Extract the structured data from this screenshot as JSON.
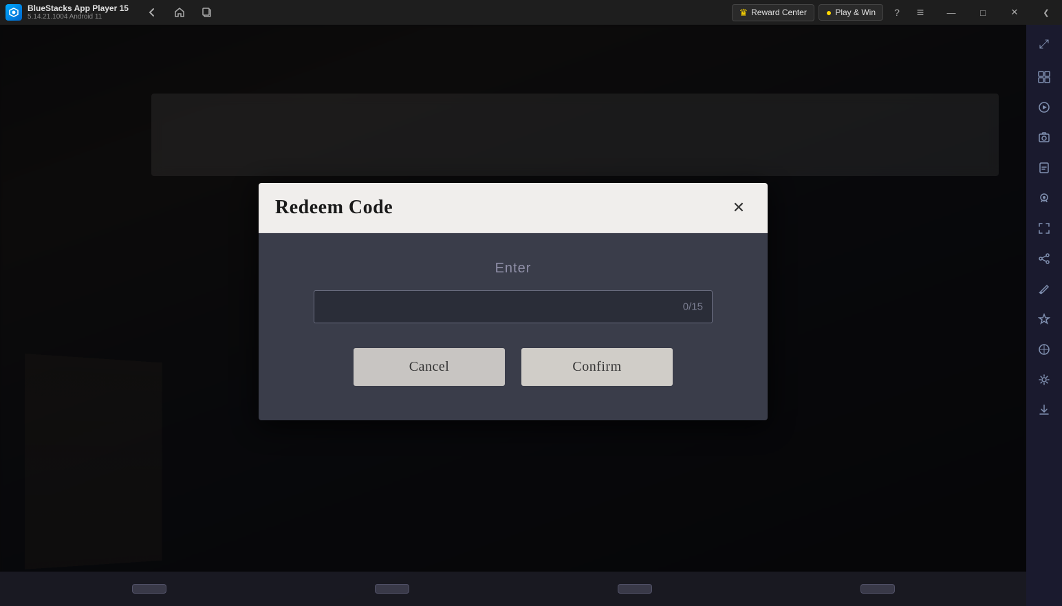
{
  "app": {
    "title": "BlueStacks App Player 15",
    "version": "5.14.21.1004  Android 11"
  },
  "titlebar": {
    "nav": {
      "back_label": "←",
      "home_label": "⌂",
      "copy_label": "❐"
    },
    "reward_center_label": "Reward Center",
    "play_win_label": "Play & Win",
    "controls": {
      "help": "?",
      "menu": "≡",
      "minimize": "—",
      "maximize": "□",
      "close": "✕",
      "collapse": "❮"
    }
  },
  "sidebar": {
    "icons": [
      {
        "name": "expand-icon",
        "symbol": "⤢"
      },
      {
        "name": "sidebar-top-icon",
        "symbol": "⊞"
      },
      {
        "name": "video-icon",
        "symbol": "▶"
      },
      {
        "name": "screenshot-icon",
        "symbol": "📷"
      },
      {
        "name": "apk-icon",
        "symbol": "📦"
      },
      {
        "name": "camera-icon",
        "symbol": "📸"
      },
      {
        "name": "resize-icon",
        "symbol": "⤡"
      },
      {
        "name": "share-icon",
        "symbol": "↗"
      },
      {
        "name": "brush-icon",
        "symbol": "✏"
      },
      {
        "name": "plane-icon",
        "symbol": "✈"
      },
      {
        "name": "planet-icon",
        "symbol": "🌐"
      },
      {
        "name": "settings-icon",
        "symbol": "⚙"
      },
      {
        "name": "download-icon",
        "symbol": "↓"
      }
    ]
  },
  "dialog": {
    "title": "Redeem Code",
    "close_label": "✕",
    "label": "Enter",
    "input": {
      "value": "",
      "placeholder": "",
      "counter": "0/15"
    },
    "cancel_label": "Cancel",
    "confirm_label": "Confirm"
  },
  "bottom_bar": {
    "buttons": [
      "button1",
      "button2",
      "button3",
      "button4"
    ]
  }
}
